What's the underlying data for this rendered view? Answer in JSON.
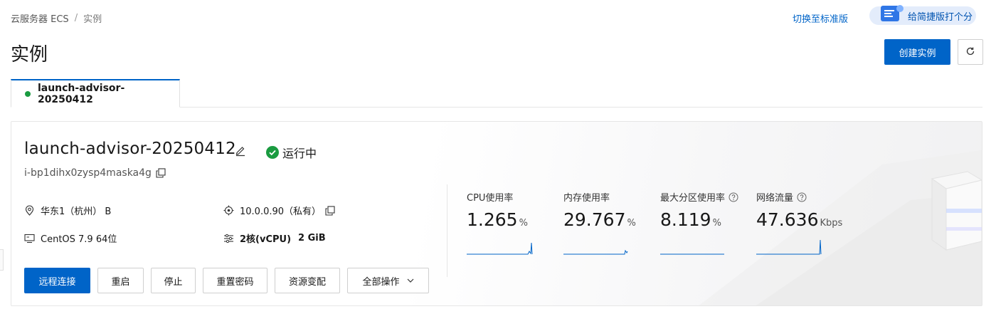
{
  "breadcrumb": {
    "root": "云服务器 ECS",
    "separator": "/",
    "current": "实例"
  },
  "header": {
    "switch_link": "切换至标准版",
    "feedback_label": "给简捷版打个分",
    "title": "实例",
    "create_button": "创建实例",
    "refresh_icon": "refresh-icon"
  },
  "tab": {
    "label": "launch-advisor-20250412",
    "status_color": "#1a9b40"
  },
  "instance": {
    "name": "launch-advisor-20250412",
    "status": "运行中",
    "id": "i-bp1dihx0zysp4maska4g",
    "region": "华东1（杭州） B",
    "ip": "10.0.0.90（私有）",
    "os": "CentOS 7.9 64位",
    "cpu_spec": "2核(vCPU)",
    "mem_spec": "2 GiB"
  },
  "metrics": [
    {
      "label": "CPU使用率",
      "value": "1.265",
      "unit": "%",
      "help": false
    },
    {
      "label": "内存使用率",
      "value": "29.767",
      "unit": "%",
      "help": false
    },
    {
      "label": "最大分区使用率",
      "value": "8.119",
      "unit": "%",
      "help": true
    },
    {
      "label": "网络流量",
      "value": "47.636",
      "unit": "Kbps",
      "help": true
    }
  ],
  "actions": {
    "remote": "远程连接",
    "reboot": "重启",
    "stop": "停止",
    "reset_password": "重置密码",
    "resize": "资源变配",
    "all_ops": "全部操作"
  },
  "colors": {
    "primary": "#0064c8",
    "success": "#1a9b40",
    "spark": "#0064c8"
  }
}
